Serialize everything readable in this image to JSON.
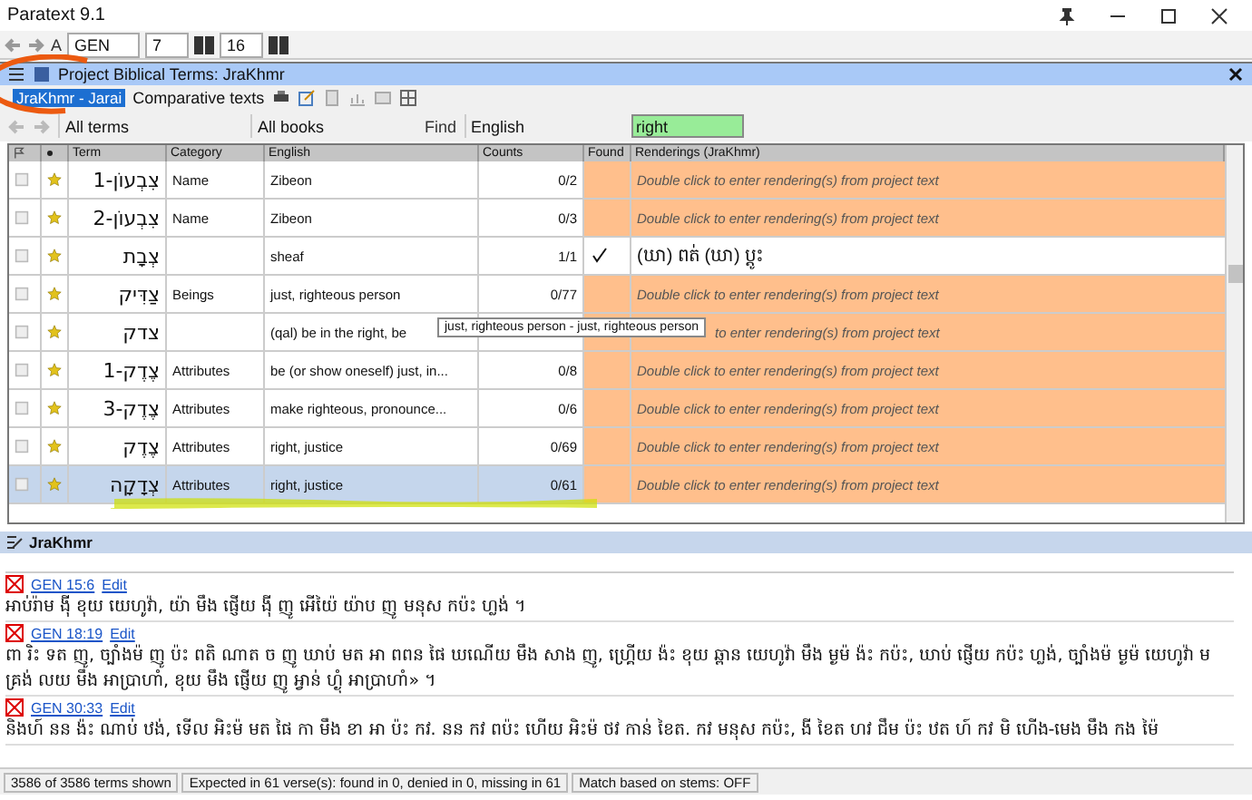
{
  "window": {
    "title": "Paratext 9.1"
  },
  "toolbar": {
    "font_button": "A",
    "book": "GEN",
    "chapter": "7",
    "verse": "16"
  },
  "panel": {
    "title": "Project Biblical Terms: JraKhmr",
    "project": "JraKhmr - Jarai",
    "comparative": "Comparative texts",
    "term_filter": "All terms",
    "book_filter": "All books",
    "find_label": "Find",
    "find_language": "English",
    "search": "right"
  },
  "table": {
    "columns": [
      "Term",
      "Category",
      "English",
      "Counts",
      "Found",
      "Renderings (JraKhmr)"
    ],
    "rows": [
      {
        "term": "צִבְעוֹן-1",
        "category": "Name",
        "english": "Zibeon",
        "counts": "0/2",
        "found": false,
        "rendering": "Double click to enter rendering(s) from project text",
        "kind": "placeholder",
        "selected": false
      },
      {
        "term": "צִבְעוֹן-2",
        "category": "Name",
        "english": "Zibeon",
        "counts": "0/3",
        "found": false,
        "rendering": "Double click to enter rendering(s) from project text",
        "kind": "placeholder",
        "selected": false
      },
      {
        "term": "צְבָת",
        "english": "sheaf",
        "counts": "1/1",
        "found": true,
        "rendering": "(ឃា) ពត់   (ឃា) ប្តូះ",
        "kind": "text",
        "selected": false
      },
      {
        "term": "צַדִּיק",
        "category": "Beings",
        "english": "just, righteous person",
        "counts": "0/77",
        "found": false,
        "rendering": "Double click to enter rendering(s) from project text",
        "kind": "placeholder",
        "selected": false
      },
      {
        "term": "צדק",
        "english": "(qal) be in the right, be",
        "found": false,
        "rendering": "to enter rendering(s) from project text",
        "kind": "partial",
        "selected": false
      },
      {
        "term": "צֶדֶק-1",
        "category": "Attributes",
        "english": "be (or show oneself) just, in...",
        "counts": "0/8",
        "found": false,
        "rendering": "Double click to enter rendering(s) from project text",
        "kind": "placeholder",
        "selected": false
      },
      {
        "term": "צֶדֶק-3",
        "category": "Attributes",
        "english": "make righteous, pronounce...",
        "counts": "0/6",
        "found": false,
        "rendering": "Double click to enter rendering(s) from project text",
        "kind": "placeholder",
        "selected": false
      },
      {
        "term": "צֶדֶק",
        "category": "Attributes",
        "english": "right, justice",
        "counts": "0/69",
        "found": false,
        "rendering": "Double click to enter rendering(s) from project text",
        "kind": "placeholder",
        "selected": false
      },
      {
        "term": "צְדָקָה",
        "category": "Attributes",
        "english": "right, justice",
        "counts": "0/61",
        "found": false,
        "rendering": "Double click to enter rendering(s) from project text",
        "kind": "placeholder",
        "selected": true
      }
    ]
  },
  "tooltip": "just, righteous person - just, righteous person",
  "verses_pane": {
    "title": "JraKhmr",
    "verses": [
      {
        "reference": "GEN 15:6",
        "edit": "Edit",
        "text": "អាប់រ៉ាម ង៉ី ខុយ យេហូវ៉ា, យ៉ា មឹង ផ្ញើយ ង៉ី ញូ អើយ៉ៃ យ៉ាប ញូ មនុស កប៉ះ ហ្លង់ ។"
      },
      {
        "reference": "GEN 18:19",
        "edit": "Edit",
        "text": "ពា រិះ ទត ញូ, ច្បាំងម៉ ញូ ប៉ះ ពតិ ណាត ច ញូ ឃាប់ មត អា ពពន ផៃ ឃណើយ មឹង សាង ញូ, ហ្គ្រើយ ង៉ះ ខុយ ឆ្ពាន យេហូវ៉ា មឹង ម្ងម៉ ង៉ះ កប៉ះ, ឃាប់ ផ្ញើយ កប៉ះ ហ្លង់, ច្បាំងម៉ ម្ងម៉ យេហូវ៉ា មគ្រង់ លយ មឹង អាប្រាហាំ, ខុយ មឹង ផ្ញើយ ញូ អ្វាន់ ហ្ង៉ំ អាប្រាហាំ» ។"
      },
      {
        "reference": "GEN 30:33",
        "edit": "Edit",
        "text": "និងហ៍ នន ង៉ះ ណាប់ ឋង់, ទើល អិះម៉ មត ផៃ កា មឹង ខា អា ប៉ះ កវ. នន កវ ពប៉ះ ហើយ អិះម៉ ថវ កាន់ ខៃត. កវ មនុស កប៉ះ, ងី ខៃត ហវ ជឹម ប៉ះ ឋត ហ៍ កវ មិ ហើង-មេង មឹង កង ម៉ៃ"
      }
    ]
  },
  "status_bar": [
    "3586 of 3586 terms shown",
    "Expected in 61 verse(s): found in 0, denied in 0, missing in 61",
    "Match based on stems: OFF"
  ]
}
